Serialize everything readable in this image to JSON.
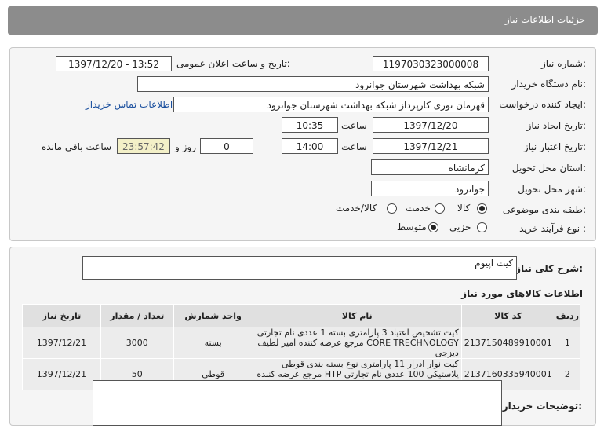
{
  "header": {
    "title": "جزئیات اطلاعات نیاز"
  },
  "form": {
    "need_number_label": "شماره نیاز:",
    "need_number": "1197030323000008",
    "announce_label": "تاریخ و ساعت اعلان عمومی:",
    "announce_value": "1397/12/20 - 13:52",
    "buyer_org_label": "نام دستگاه خریدار:",
    "buyer_org": "شبکه بهداشت شهرستان جوانرود",
    "requester_label": "ایجاد کننده درخواست:",
    "requester": "قهرمان نوری کارپرداز شبکه بهداشت شهرستان جوانرود",
    "contact_link": "اطلاعات تماس خریدار",
    "created_label": "تاریخ ایجاد نیاز:",
    "created_date": "1397/12/20",
    "created_time_label": "ساعت",
    "created_time": "10:35",
    "validity_label": "تاریخ اعتبار نیاز:",
    "validity_date": "1397/12/21",
    "validity_time_label": "ساعت",
    "validity_time": "14:00",
    "days_value": "0",
    "days_label": "روز و",
    "remaining_time": "23:57:42",
    "remaining_label": "ساعت باقی مانده",
    "province_label": "استان محل تحویل:",
    "province": "کرمانشاه",
    "city_label": "شهر محل تحویل:",
    "city": "جوانرود",
    "category_label": "طبقه بندی موضوعی:",
    "category_options": [
      "کالا",
      "خدمت",
      "کالا/خدمت"
    ],
    "category_selected": "کالا",
    "process_label": "نوع فرآیند خرید :",
    "process_options": [
      "جزیی",
      "متوسط"
    ],
    "process_selected": "متوسط"
  },
  "summary": {
    "label": "شرح کلی نیاز:",
    "value": "کیت اپیوم"
  },
  "items_section": {
    "title": "اطلاعات کالاهای مورد نیاز",
    "columns": [
      "ردیف",
      "کد کالا",
      "نام کالا",
      "واحد شمارش",
      "تعداد / مقدار",
      "تاریخ نیاز"
    ],
    "rows": [
      {
        "row": "1",
        "code": "2137150489910001",
        "name": "کیت تشخیص اعتیاد 3 پارامتری بسته 1 عددی نام تجارتی CORE TRECHNOLOGY مرجع عرضه کننده امیر لطیف دیزجی",
        "unit": "بسته",
        "qty": "3000",
        "date": "1397/12/21"
      },
      {
        "row": "2",
        "code": "2137160335940001",
        "name": "کیت نوار ادرار 11 پارامتری نوع بسته بندی قوطی پلاستیکی 100 عددی نام تجارتی HTP مرجع عرضه کننده حنان طب پارس",
        "unit": "قوطی",
        "qty": "50",
        "date": "1397/12/21"
      }
    ]
  },
  "buyer_notes": {
    "label": "توضیحات خریدار:",
    "value": ""
  }
}
